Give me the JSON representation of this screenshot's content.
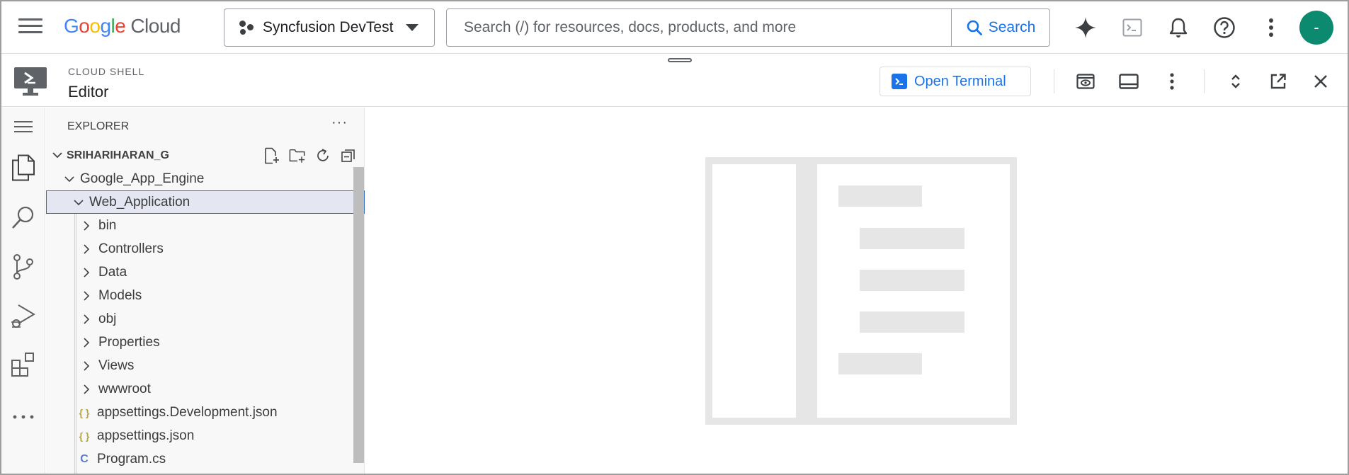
{
  "topbar": {
    "logo": {
      "letters": [
        "G",
        "o",
        "o",
        "g",
        "l",
        "e"
      ],
      "product": "Cloud"
    },
    "project": {
      "label": "Syncfusion DevTest"
    },
    "search": {
      "placeholder": "Search (/) for resources, docs, products, and more",
      "button_label": "Search"
    },
    "icons": [
      "gemini-sparkle-icon",
      "cloud-shell-icon",
      "notifications-bell-icon",
      "help-icon",
      "more-vert-icon"
    ],
    "avatar_initial": "-"
  },
  "shell": {
    "kicker": "CLOUD SHELL",
    "title": "Editor",
    "open_terminal_label": "Open Terminal"
  },
  "explorer": {
    "title": "EXPLORER",
    "root": "SRIHARIHARAN_G",
    "items": [
      {
        "label": "Google_App_Engine",
        "kind": "folder-open"
      },
      {
        "label": "Web_Application",
        "kind": "folder-open",
        "selected": true
      },
      {
        "label": "bin",
        "kind": "folder"
      },
      {
        "label": "Controllers",
        "kind": "folder"
      },
      {
        "label": "Data",
        "kind": "folder"
      },
      {
        "label": "Models",
        "kind": "folder"
      },
      {
        "label": "obj",
        "kind": "folder"
      },
      {
        "label": "Properties",
        "kind": "folder"
      },
      {
        "label": "Views",
        "kind": "folder"
      },
      {
        "label": "wwwroot",
        "kind": "folder"
      },
      {
        "label": "appsettings.Development.json",
        "kind": "json",
        "icon_text": "{ }"
      },
      {
        "label": "appsettings.json",
        "kind": "json",
        "icon_text": "{ }"
      },
      {
        "label": "Program.cs",
        "kind": "csharp",
        "icon_text": "C"
      }
    ]
  },
  "colors": {
    "accent": "#1a73e8",
    "avatar": "#0b8a6f",
    "json_icon": "#b5a642",
    "csharp_icon": "#5a7dc6"
  }
}
